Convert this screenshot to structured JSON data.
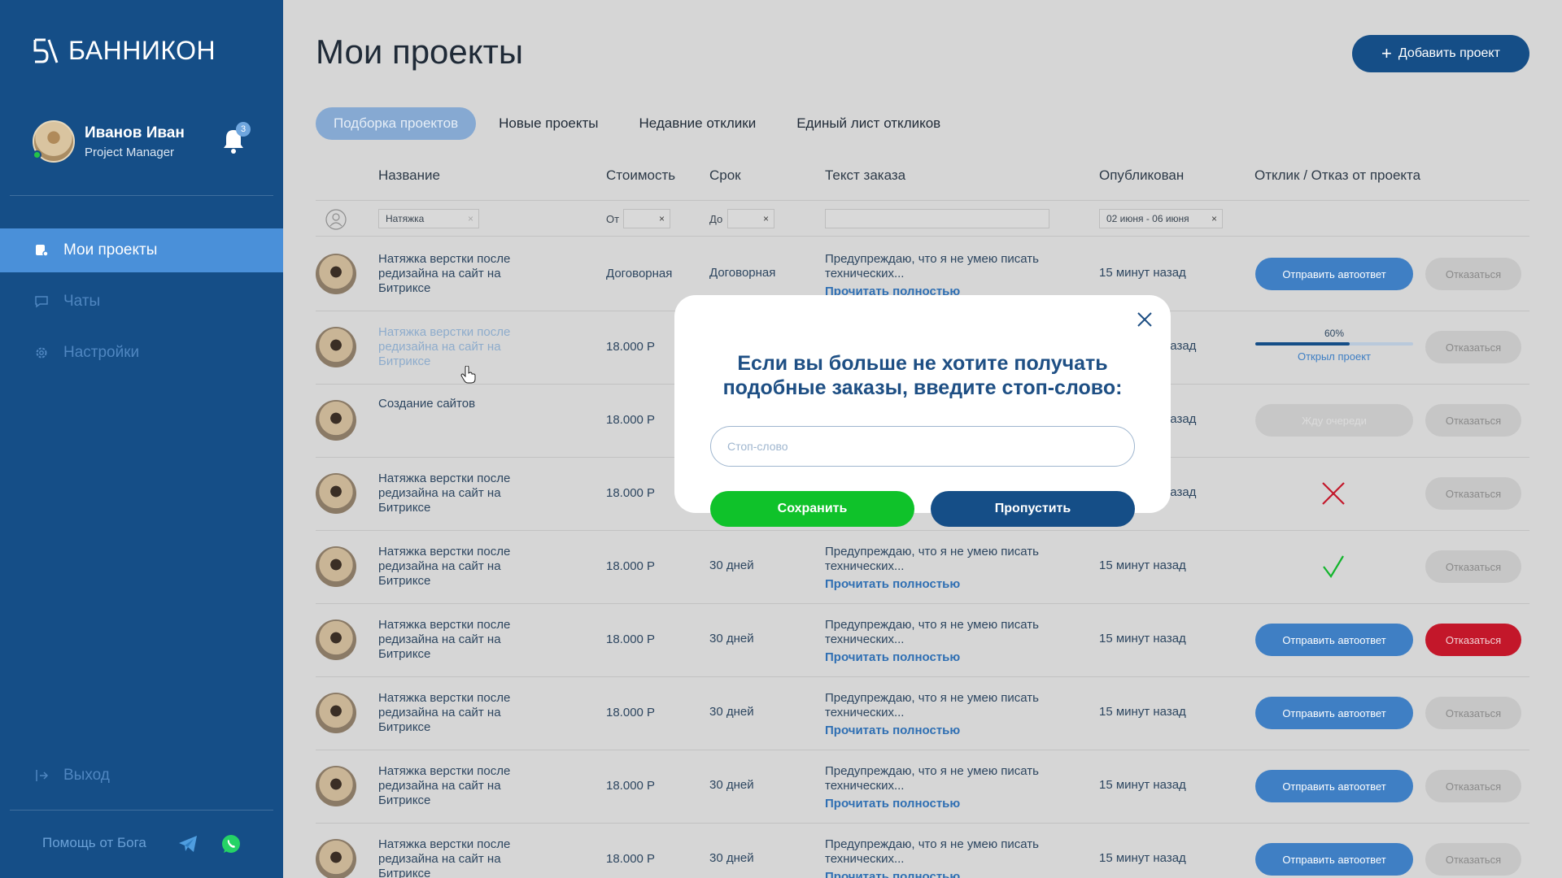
{
  "app": {
    "logo_text": "БАННИКОН"
  },
  "user": {
    "name": "Иванов Иван",
    "role": "Project Manager",
    "notifications": "3"
  },
  "nav": [
    {
      "label": "Мои проекты"
    },
    {
      "label": "Чаты"
    },
    {
      "label": "Настройки"
    }
  ],
  "logout_label": "Выход",
  "help_label": "Помощь от Бога",
  "page": {
    "title": "Мои проекты",
    "add_label": "Добавить проект"
  },
  "tabs": [
    "Подборка проектов",
    "Новые проекты",
    "Недавние отклики",
    "Единый лист откликов"
  ],
  "columns": [
    "Название",
    "Стоимость",
    "Срок",
    "Текст заказа",
    "Опубликован",
    "Отклик / Отказ от проекта"
  ],
  "filters": {
    "name": "Натяжка",
    "cost_label": "От",
    "term_label": "До",
    "date_range": "02 июня - 06 июня",
    "clear": "×"
  },
  "rows": [
    {
      "title": "Натяжка верстки после редизайна на сайт на Битриксе",
      "cost": "Договорная",
      "term": "Договорная",
      "text": "Предупреждаю, что я не умею писать технических...",
      "read_more": "Прочитать полностью",
      "published": "15 минут назад",
      "action": "auto",
      "action_label": "Отправить автоответ",
      "reject": "Отказаться",
      "reject_style": "gray"
    },
    {
      "title": "Натяжка верстки после редизайна на сайт на Битриксе",
      "cost": "18.000 Р",
      "term": "",
      "text": "",
      "read_more": "",
      "published": "назад",
      "action": "progress",
      "progress": 60,
      "progress_label": "60%",
      "progress_caption": "Открыл проект",
      "reject": "Отказаться",
      "reject_style": "gray",
      "faded": true
    },
    {
      "title": "Создание сайтов",
      "cost": "18.000 Р",
      "term": "",
      "text": "",
      "read_more": "",
      "published": "назад",
      "action": "wait",
      "action_label": "Жду очереди",
      "reject": "Отказаться",
      "reject_style": "gray"
    },
    {
      "title": "Натяжка верстки после редизайна на сайт на Битриксе",
      "cost": "18.000 Р",
      "term": "",
      "text": "",
      "read_more": "",
      "published": "назад",
      "action": "cross",
      "reject": "Отказаться",
      "reject_style": "gray"
    },
    {
      "title": "Натяжка верстки после редизайна на сайт на Битриксе",
      "cost": "18.000 Р",
      "term": "30 дней",
      "text": "Предупреждаю, что я не умею писать технических...",
      "read_more": "Прочитать полностью",
      "published": "15 минут назад",
      "action": "check",
      "reject": "Отказаться",
      "reject_style": "gray"
    },
    {
      "title": "Натяжка верстки после редизайна на сайт на Битриксе",
      "cost": "18.000 Р",
      "term": "30 дней",
      "text": "Предупреждаю, что я не умею писать технических...",
      "read_more": "Прочитать полностью",
      "published": "15 минут назад",
      "action": "auto",
      "action_label": "Отправить автоответ",
      "reject": "Отказаться",
      "reject_style": "red"
    },
    {
      "title": "Натяжка верстки после редизайна на сайт на Битриксе",
      "cost": "18.000 Р",
      "term": "30 дней",
      "text": "Предупреждаю, что я не умею писать технических...",
      "read_more": "Прочитать полностью",
      "published": "15 минут назад",
      "action": "auto",
      "action_label": "Отправить автоответ",
      "reject": "Отказаться",
      "reject_style": "gray"
    },
    {
      "title": "Натяжка верстки после редизайна на сайт на Битриксе",
      "cost": "18.000 Р",
      "term": "30 дней",
      "text": "Предупреждаю, что я не умею писать технических...",
      "read_more": "Прочитать полностью",
      "published": "15 минут назад",
      "action": "auto",
      "action_label": "Отправить автоответ",
      "reject": "Отказаться",
      "reject_style": "gray"
    },
    {
      "title": "Натяжка верстки после редизайна на сайт на Битриксе",
      "cost": "18.000 Р",
      "term": "30 дней",
      "text": "Предупреждаю, что я не умею писать технических...",
      "read_more": "Прочитать полностью",
      "published": "15 минут назад",
      "action": "auto",
      "action_label": "Отправить автоответ",
      "reject": "Отказаться",
      "reject_style": "gray"
    }
  ],
  "modal": {
    "title_line1": "Если вы больше не хотите получать",
    "title_line2": "подобные заказы, введите стоп-слово:",
    "input_placeholder": "Стоп-слово",
    "save_label": "Сохранить",
    "skip_label": "Пропустить"
  },
  "colors": {
    "sidebar": "#154e87",
    "accent": "#4a90d9",
    "save": "#0fc22a",
    "reject_active": "#c3172a"
  }
}
